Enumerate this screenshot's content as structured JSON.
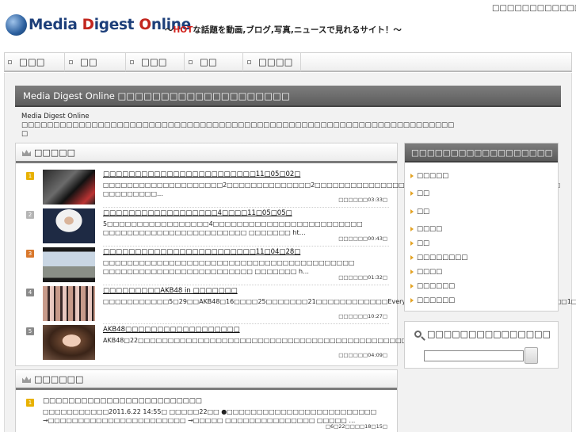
{
  "header": {
    "logo_main": "Media ",
    "logo_d": "D",
    "logo_igest": "igest ",
    "logo_o": "O",
    "logo_nline": "nline",
    "tagline_pre": "〜",
    "tagline_hot": "HOT",
    "tagline_post": "な話題を動画,ブログ,写真,ニュースで見れるサイト！〜",
    "top_link": "□□□□□□□□□□□□□□"
  },
  "nav": {
    "items": [
      {
        "label": "□□□"
      },
      {
        "label": "□□"
      },
      {
        "label": "□□□"
      },
      {
        "label": "□□"
      },
      {
        "label": "□□□□"
      }
    ]
  },
  "main": {
    "heading": "Media Digest Online □□□□□□□□□□□□□□□□□□□□",
    "intro": "Media Digest Online □□□□□□□□□□□□□□□□□□□□□□□□□□□□□□□□□□□□□□□□□□□□□□□□□□□□□□□□□□□□□□□□□□□□ □"
  },
  "ranking": {
    "title": "□□□□□",
    "items": [
      {
        "num": "1",
        "color": "#e8b100",
        "title": "□□□□□□□□□□□□□□□□□□□□□□□□11□05□02□",
        "desc": "□□□□□□□□□□□□□□□□□□□□2□□□□□□□□□□□□□□2□□□□□□□□□□□□□□□□□□□□□□□□□□□□□□□□□□□□□□□□□ □□□□□□□□□…",
        "meta": "□□□□□□03:33□"
      },
      {
        "num": "2",
        "color": "#b5b5b5",
        "title": "□□□□□□□□□□□□□□□□□□4□□□□11□05□05□",
        "desc": "5□□□□□□□□□□□□□□□□□4□□□□□□□□□□□□□□□□□□□□□□□□□ □□□□□□□□□□□□□□□□□□□□□□□□ □□□□□□□ ht…",
        "meta": "□□□□□□00:43□"
      },
      {
        "num": "3",
        "color": "#d9782c",
        "title": "□□□□□□□□□□□□□□□□□□□□□□□□11□04□28□",
        "desc": "□□□□□□□□□□□□□□□□□□□□□□□□□□□□□□□□□□□□□□□□□□ □□□□□□□□□□□□□□□□□□□□□□□□□ □□□□□□□ h…",
        "meta": "□□□□□□01:32□"
      },
      {
        "num": "4",
        "color": "#8a8a8a",
        "title": "□□□□□□□□□AKB48 in □□□□□□□",
        "desc": "□□□□□□□□□□□5□29□□AKB48□16□□□□25□□□□□□□21□□□□□□□□□□□□Everyday□□□□□□□□□□□□□□□□□□□□□□□□□1□…",
        "meta": "□□□□□□10:27□"
      },
      {
        "num": "5",
        "color": "#8a8a8a",
        "title": "AKB48□□□□□□□□□□□□□□□□□□",
        "desc": "AKB48□22□□□□□□□□□□□□□□□□□□□□□□□□□□□□□□□□□□□□□□□□□□□□□□□□□□□□□□□□□□□□□□□□□□□…",
        "meta": "□□□□□□04:09□"
      }
    ]
  },
  "news": {
    "title": "□□□□□□",
    "items": [
      {
        "num": "1",
        "color": "#e8b100",
        "title": "□□□□□□□□□□□□□□□□□□□□□□□□□",
        "desc": "□□□□□□□□□□□2011.6.22 14:55□ □□□□□22□□ ●□□□□□□□□□□□□□□□□□□□□□□□□□ →□□□□□□□□□□□□□□□□□□□□□□□ →□□□□□ □□□□□□□□□□□□□□□ □□□□□ …",
        "meta": "□6□22□□□□18□15□"
      }
    ]
  },
  "sidebar": {
    "heading": "□□□□□□□□□□□□□□□□□□",
    "items": [
      {
        "label": "□□□□□"
      },
      {
        "label": "□□"
      },
      {
        "label": "□□"
      },
      {
        "label": "□□□□"
      },
      {
        "label": "□□"
      },
      {
        "label": "□□□□□□□□"
      },
      {
        "label": "□□□□"
      },
      {
        "label": "□□□□□□"
      },
      {
        "label": "□□□□□□"
      }
    ],
    "search_title": "□□□□□□□□□□□□□□□"
  }
}
